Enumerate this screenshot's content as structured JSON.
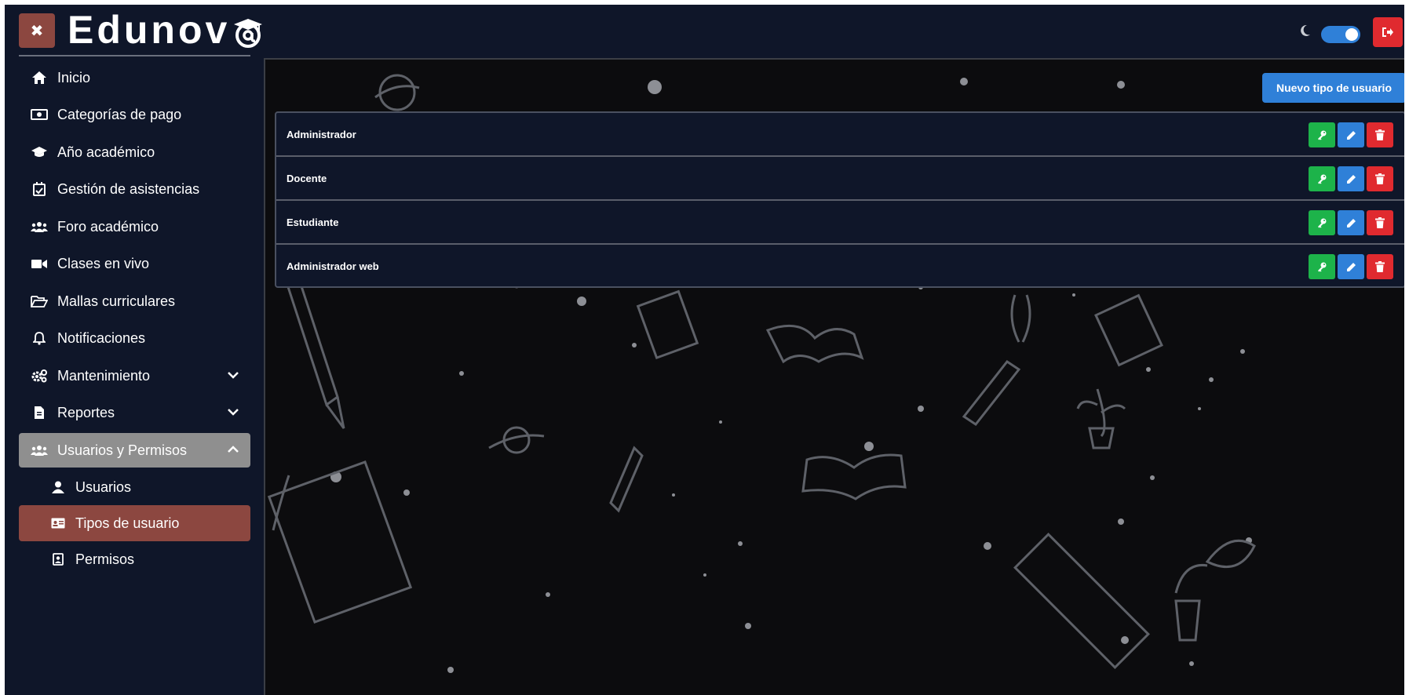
{
  "app": {
    "logo_text": "Edunov"
  },
  "header": {
    "close_icon": "close-icon",
    "moon_icon": "moon-icon",
    "logout_icon": "logout-icon",
    "theme_toggle_on": true,
    "colors": {
      "brand": "#8c4740",
      "toggle": "#2f80d8",
      "logout": "#e02a2f"
    }
  },
  "sidebar": {
    "items": [
      {
        "label": "Inicio",
        "icon": "home-icon"
      },
      {
        "label": "Categorías de pago",
        "icon": "money-icon"
      },
      {
        "label": "Año académico",
        "icon": "graduation-cap-icon"
      },
      {
        "label": "Gestión de asistencias",
        "icon": "calendar-check-icon"
      },
      {
        "label": "Foro académico",
        "icon": "users-icon"
      },
      {
        "label": "Clases en vivo",
        "icon": "video-icon"
      },
      {
        "label": "Mallas curriculares",
        "icon": "folder-open-icon"
      },
      {
        "label": "Notificaciones",
        "icon": "bell-icon"
      },
      {
        "label": "Mantenimiento",
        "icon": "gears-icon",
        "expandable": true
      },
      {
        "label": "Reportes",
        "icon": "file-icon",
        "expandable": true
      },
      {
        "label": "Usuarios y Permisos",
        "icon": "users-icon",
        "expandable": true,
        "expanded": true
      }
    ],
    "sub_items": [
      {
        "label": "Usuarios",
        "icon": "user-icon"
      },
      {
        "label": "Tipos de usuario",
        "icon": "id-card-icon",
        "active": true
      },
      {
        "label": "Permisos",
        "icon": "contact-card-icon"
      }
    ]
  },
  "main": {
    "new_button_label": "Nuevo tipo de usuario",
    "user_types": [
      {
        "name": "Administrador"
      },
      {
        "name": "Docente"
      },
      {
        "name": "Estudiante"
      },
      {
        "name": "Administrador web"
      }
    ],
    "row_actions": [
      {
        "icon": "key-icon",
        "color": "#1db34a"
      },
      {
        "icon": "pencil-icon",
        "color": "#2f80d8"
      },
      {
        "icon": "trash-icon",
        "color": "#e02a2f"
      }
    ]
  }
}
